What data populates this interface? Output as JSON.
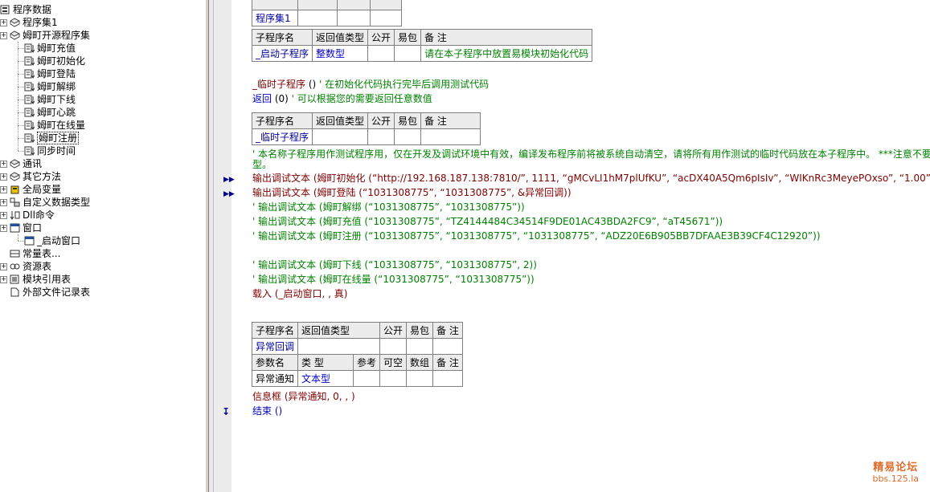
{
  "tree": {
    "root": "程序数据",
    "items": [
      {
        "label": "程序集1",
        "level": 1,
        "icon": "module-icon",
        "expander": true
      },
      {
        "label": "姆町开源程序集",
        "level": 1,
        "icon": "module-icon",
        "expander": true
      },
      {
        "label": "姆町充值",
        "level": 2,
        "icon": "sub-icon"
      },
      {
        "label": "姆町初始化",
        "level": 2,
        "icon": "sub-icon"
      },
      {
        "label": "姆町登陆",
        "level": 2,
        "icon": "sub-icon"
      },
      {
        "label": "姆町解绑",
        "level": 2,
        "icon": "sub-icon"
      },
      {
        "label": "姆町下线",
        "level": 2,
        "icon": "sub-icon"
      },
      {
        "label": "姆町心跳",
        "level": 2,
        "icon": "sub-icon"
      },
      {
        "label": "姆町在线量",
        "level": 2,
        "icon": "sub-icon"
      },
      {
        "label": "姆町注册",
        "level": 2,
        "icon": "sub-icon",
        "selected": true
      },
      {
        "label": "同步时间",
        "level": 2,
        "icon": "sub-icon"
      },
      {
        "label": "通讯",
        "level": 1,
        "icon": "module-icon",
        "expander": true
      },
      {
        "label": "其它方法",
        "level": 1,
        "icon": "module-icon",
        "expander": true
      },
      {
        "label": "全局变量",
        "level": 1,
        "icon": "global-icon",
        "expander": true
      },
      {
        "label": "自定义数据类型",
        "level": 1,
        "icon": "datatype-icon",
        "expander": true
      },
      {
        "label": "Dll命令",
        "level": 1,
        "icon": "dll-icon",
        "expander": true
      },
      {
        "label": "窗口",
        "level": 1,
        "icon": "window-icon",
        "expander": true
      },
      {
        "label": "_启动窗口",
        "level": 2,
        "icon": "window-icon"
      },
      {
        "label": "常量表...",
        "level": 1,
        "icon": "const-icon"
      },
      {
        "label": "资源表",
        "level": 1,
        "icon": "resource-icon",
        "expander": true
      },
      {
        "label": "模块引用表",
        "level": 1,
        "icon": "moduleref-icon",
        "expander": true
      },
      {
        "label": "外部文件记录表",
        "level": 1,
        "icon": "file-icon"
      }
    ]
  },
  "top_table": {
    "cells": [
      "程序集1",
      "",
      "",
      ""
    ]
  },
  "sub1_table": {
    "headers": [
      "子程序名",
      "返回值类型",
      "公开",
      "易包",
      "备 注"
    ],
    "row": [
      "_启动子程序",
      "整数型",
      "",
      "",
      "请在本子程序中放置易模块初始化代码"
    ]
  },
  "code1": [
    {
      "parts": [
        [
          "_临时子程序",
          "red"
        ],
        [
          " () ",
          "plain"
        ],
        [
          "' 在初始化代码执行完毕后调用测试代码",
          "green"
        ]
      ]
    },
    {
      "parts": [
        [
          "返回",
          "blue"
        ],
        [
          " (0) ",
          "plain"
        ],
        [
          "' 可以根据您的需要返回任意数值",
          "green"
        ]
      ]
    }
  ],
  "sub2_table": {
    "headers": [
      "子程序名",
      "返回值类型",
      "公开",
      "易包",
      "备 注"
    ],
    "row": [
      "_临时子程序",
      "",
      "",
      "",
      ""
    ]
  },
  "comment_long": "' 本名称子程序用作测试程序用，仅在开发及调试环境中有效，编译发布程序前将被系统自动清空，请将所有用作测试的临时代码放在本子程序中。 ***注意不要",
  "comment_long_2": "型。",
  "code2": [
    {
      "arrow": true,
      "text": "输出调试文本 (姆町初始化 (“http://192.168.187.138:7810/”, 1111, “gMCvLI1hM7plUfKU”, “acDX40A5Qm6pIsIv”, “WIKnRc3MeyePOxso”, “1.00”,",
      "cls": "red"
    },
    {
      "arrow": true,
      "text": "输出调试文本 (姆町登陆 (“1031308775”, “1031308775”, &异常回调))",
      "cls": "red"
    },
    {
      "arrow": false,
      "text": "' 输出调试文本 (姆町解绑 (“1031308775”, “1031308775”))",
      "cls": "green"
    },
    {
      "arrow": false,
      "text": "' 输出调试文本 (姆町充值 (“1031308775”, “TZ4144484C34514F9DE01AC43BDA2FC9”, “aT45671”))",
      "cls": "green"
    },
    {
      "arrow": false,
      "text": "' 输出调试文本 (姆町注册 (“1031308775”, “1031308775”, “1031308775”, “ADZ20E6B905BB7DFAAE3B39CF4C12920”))",
      "cls": "green"
    },
    {
      "arrow": false,
      "text": "",
      "cls": "plain"
    },
    {
      "arrow": false,
      "text": "' 输出调试文本 (姆町下线 (“1031308775”, “1031308775”, 2))",
      "cls": "green"
    },
    {
      "arrow": false,
      "text": "' 输出调试文本 (姆町在线量 (“1031308775”, “1031308775”))",
      "cls": "green"
    },
    {
      "arrow": false,
      "text": "载入 (_启动窗口, , 真)",
      "cls": "red"
    }
  ],
  "sub3_table": {
    "headers": [
      "子程序名",
      "返回值类型",
      "公开",
      "易包",
      "备 注"
    ],
    "row": [
      "异常回调",
      "",
      "",
      "",
      ""
    ],
    "param_headers": [
      "参数名",
      "类 型",
      "参考",
      "可空",
      "数组",
      "备 注"
    ],
    "param_row": [
      "异常通知",
      "文本型",
      "",
      "",
      "",
      ""
    ]
  },
  "code3": [
    {
      "text": "信息框 (异常通知, 0, , )",
      "cls": "red"
    },
    {
      "text": "结束 ()",
      "cls": "blue"
    }
  ],
  "watermark": {
    "line1": "精易论坛",
    "line2": "bbs.125.la"
  }
}
